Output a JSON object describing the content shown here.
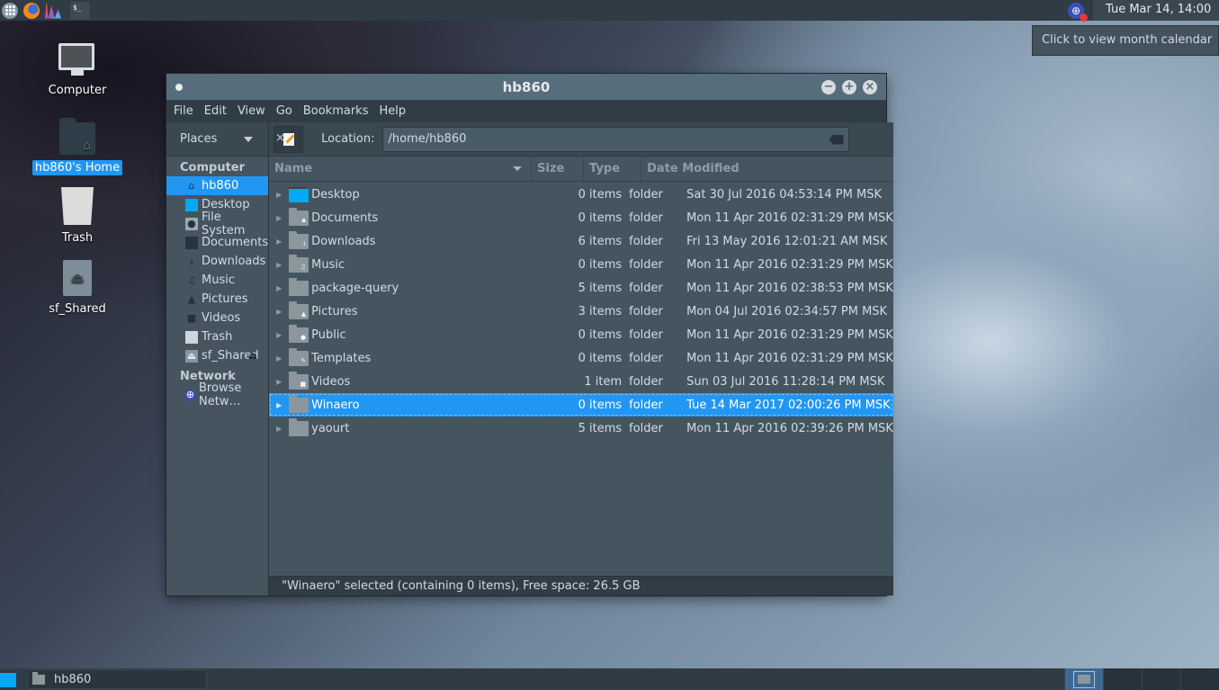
{
  "topbar": {
    "launchers": [
      {
        "name": "apps-menu",
        "icon": "apps-grid-icon"
      },
      {
        "name": "firefox",
        "icon": "firefox-icon"
      },
      {
        "name": "paint",
        "icon": "paint-brush-icon"
      },
      {
        "name": "terminal",
        "icon": "terminal-icon",
        "glyph": "$_"
      }
    ],
    "network_icon": "network-disconnected-icon",
    "clock": "Tue Mar 14, 14:00",
    "tooltip": "Click to view month calendar"
  },
  "desktop": {
    "icons": [
      {
        "label": "Computer",
        "icon": "computer-icon",
        "selected": false
      },
      {
        "label": "hb860's Home",
        "icon": "home-folder-icon",
        "selected": true
      },
      {
        "label": "Trash",
        "icon": "trash-icon",
        "selected": false
      },
      {
        "label": "sf_Shared",
        "icon": "drive-eject-icon",
        "selected": false
      }
    ]
  },
  "window": {
    "title": "hb860",
    "controls": {
      "minimize": "−",
      "maximize": "+",
      "close": "×"
    },
    "menu": [
      "File",
      "Edit",
      "View",
      "Go",
      "Bookmarks",
      "Help"
    ],
    "sidebar": {
      "header": "Places",
      "close_glyph": "×",
      "sections": [
        {
          "title": "Computer",
          "items": [
            {
              "label": "hb860",
              "icon": "home-icon",
              "selected": true
            },
            {
              "label": "Desktop",
              "icon": "desktop-icon",
              "selected": false
            },
            {
              "label": "File System",
              "icon": "filesystem-icon",
              "selected": false
            },
            {
              "label": "Documents",
              "icon": "document-icon",
              "selected": false
            },
            {
              "label": "Downloads",
              "icon": "download-icon",
              "selected": false
            },
            {
              "label": "Music",
              "icon": "music-icon",
              "selected": false
            },
            {
              "label": "Pictures",
              "icon": "pictures-icon",
              "selected": false
            },
            {
              "label": "Videos",
              "icon": "video-icon",
              "selected": false
            },
            {
              "label": "Trash",
              "icon": "trash-icon",
              "selected": false
            },
            {
              "label": "sf_Shared",
              "icon": "drive-icon",
              "selected": false,
              "eject": true
            }
          ]
        },
        {
          "title": "Network",
          "items": [
            {
              "label": "Browse Netw…",
              "icon": "network-icon",
              "selected": false
            }
          ]
        }
      ]
    },
    "location": {
      "label": "Location:",
      "value": "/home/hb860"
    },
    "columns": {
      "name": "Name",
      "size": "Size",
      "type": "Type",
      "date": "Date Modified"
    },
    "files": [
      {
        "name": "Desktop",
        "size": "0 items",
        "type": "folder",
        "date": "Sat 30 Jul 2016 04:53:14 PM MSK",
        "emblem": "desktop"
      },
      {
        "name": "Documents",
        "size": "0 items",
        "type": "folder",
        "date": "Mon 11 Apr 2016 02:31:29 PM MSK",
        "emblem": "document"
      },
      {
        "name": "Downloads",
        "size": "6 items",
        "type": "folder",
        "date": "Fri 13 May 2016 12:01:21 AM MSK",
        "emblem": "download"
      },
      {
        "name": "Music",
        "size": "0 items",
        "type": "folder",
        "date": "Mon 11 Apr 2016 02:31:29 PM MSK",
        "emblem": "music"
      },
      {
        "name": "package-query",
        "size": "5 items",
        "type": "folder",
        "date": "Mon 11 Apr 2016 02:38:53 PM MSK",
        "emblem": ""
      },
      {
        "name": "Pictures",
        "size": "3 items",
        "type": "folder",
        "date": "Mon 04 Jul 2016 02:34:57 PM MSK",
        "emblem": "pictures"
      },
      {
        "name": "Public",
        "size": "0 items",
        "type": "folder",
        "date": "Mon 11 Apr 2016 02:31:29 PM MSK",
        "emblem": "public"
      },
      {
        "name": "Templates",
        "size": "0 items",
        "type": "folder",
        "date": "Mon 11 Apr 2016 02:31:29 PM MSK",
        "emblem": "templates"
      },
      {
        "name": "Videos",
        "size": "1 item",
        "type": "folder",
        "date": "Sun 03 Jul 2016 11:28:14 PM MSK",
        "emblem": "video"
      },
      {
        "name": "Winaero",
        "size": "0 items",
        "type": "folder",
        "date": "Tue 14 Mar 2017 02:00:26 PM MSK",
        "emblem": "",
        "selected": true
      },
      {
        "name": "yaourt",
        "size": "5 items",
        "type": "folder",
        "date": "Mon 11 Apr 2016 02:39:26 PM MSK",
        "emblem": ""
      }
    ],
    "status": "\"Winaero\" selected (containing 0 items), Free space: 26.5 GB"
  },
  "taskbar": {
    "windows": [
      {
        "label": "hb860",
        "icon": "home-folder-icon"
      }
    ],
    "workspaces": 4,
    "active_workspace": 1
  },
  "colors": {
    "accent": "#2196f3",
    "titlebar": "#566d7b",
    "panel": "#2f3b45"
  }
}
